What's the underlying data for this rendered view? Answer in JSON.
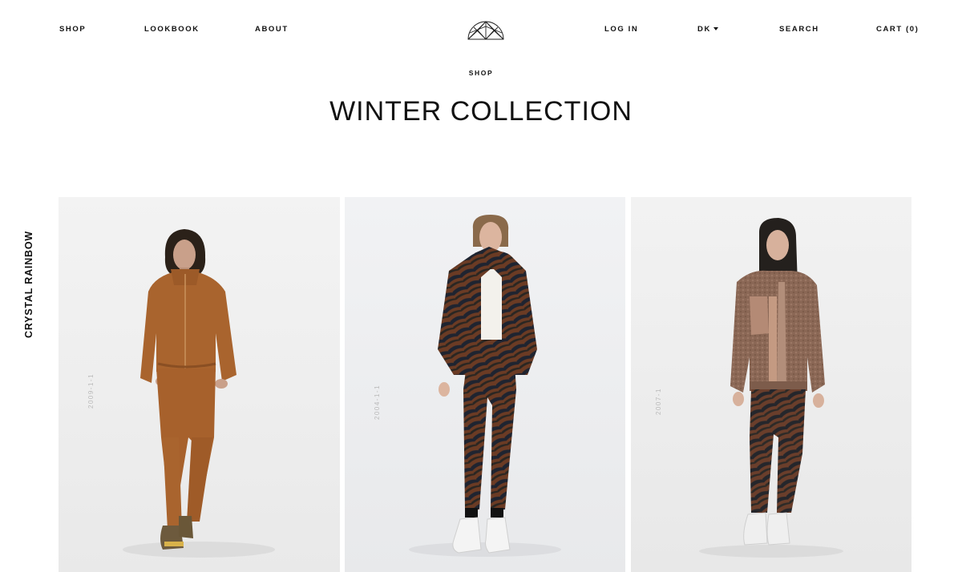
{
  "nav": {
    "shop": "SHOP",
    "lookbook": "LOOKBOOK",
    "about": "ABOUT",
    "login": "LOG IN",
    "region": "DK",
    "search": "SEARCH",
    "cart": "CART (0)"
  },
  "breadcrumb": "SHOP",
  "title": "WINTER COLLECTION",
  "side_label": "CRYSTAL RAINBOW",
  "products": [
    {
      "sku": "2009-1-1",
      "background": "#f0f0f0",
      "outfit": "rust quilted jumpsuit"
    },
    {
      "sku": "2004-1-1",
      "background": "#eff0f2",
      "outfit": "zebra print jacket and joggers"
    },
    {
      "sku": "2007-1",
      "background": "#efefef",
      "outfit": "teddy fleece jacket and zebra joggers"
    }
  ],
  "colors": {
    "text": "#111111",
    "sku_text": "#b9b9b9",
    "rust": "#a9642e",
    "zebra_base": "#6b3b24",
    "zebra_stripe": "#1f2430",
    "fleece": "#8a6755"
  }
}
